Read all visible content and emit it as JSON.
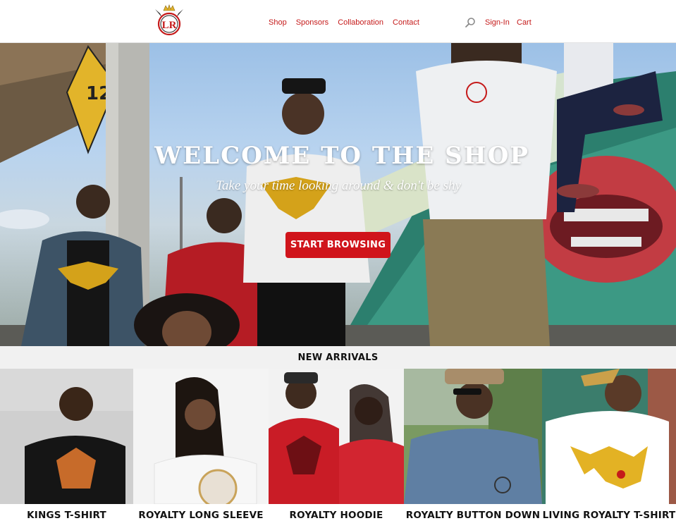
{
  "header": {
    "nav": [
      {
        "label": "Shop"
      },
      {
        "label": "Sponsors"
      },
      {
        "label": "Collaboration"
      },
      {
        "label": "Contact"
      }
    ],
    "sign_in": "Sign-In",
    "cart": "Cart",
    "logo_text": "LR",
    "icons": {
      "search": "search-icon",
      "logo": "crown-logo"
    }
  },
  "hero": {
    "title": "WELCOME TO THE SHOP",
    "subtitle": "Take your time looking around & don't be shy",
    "button": "START BROWSING",
    "sign_text": "12"
  },
  "arrivals": {
    "title": "NEW ARRIVALS",
    "products": [
      {
        "name": "KINGS T-SHIRT"
      },
      {
        "name": "ROYALTY LONG SLEEVE"
      },
      {
        "name": "ROYALTY HOODIE"
      },
      {
        "name": "ROYALTY BUTTON DOWN"
      },
      {
        "name": "LIVING ROYALTY T-SHIRT"
      }
    ]
  },
  "colors": {
    "accent": "#c51a1a",
    "button": "#d0141b",
    "text": "#111111"
  }
}
